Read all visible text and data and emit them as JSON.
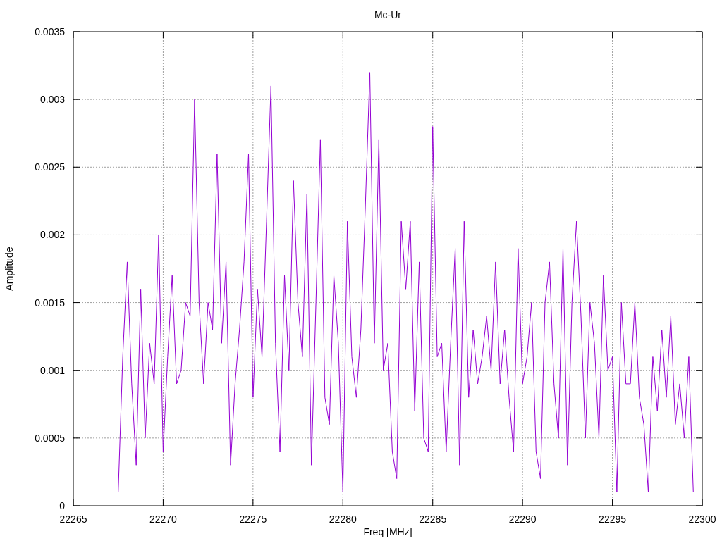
{
  "chart_data": {
    "type": "line",
    "title": "Mc-Ur",
    "xlabel": "Freq [MHz]",
    "ylabel": "Amplitude",
    "grid": true,
    "xlim": [
      22265,
      22300
    ],
    "ylim": [
      0,
      0.0035
    ],
    "xticks": [
      22265,
      22270,
      22275,
      22280,
      22285,
      22290,
      22295,
      22300
    ],
    "yticks": [
      0,
      0.0005,
      0.001,
      0.0015,
      0.002,
      0.0025,
      0.003,
      0.0035
    ],
    "x": [
      22267.5,
      22267.75,
      22268,
      22268.25,
      22268.5,
      22268.75,
      22269,
      22269.25,
      22269.5,
      22269.75,
      22270,
      22270.25,
      22270.5,
      22270.75,
      22271,
      22271.25,
      22271.5,
      22271.75,
      22272,
      22272.25,
      22272.5,
      22272.75,
      22273,
      22273.25,
      22273.5,
      22273.75,
      22274,
      22274.25,
      22274.5,
      22274.75,
      22275,
      22275.25,
      22275.5,
      22275.75,
      22276,
      22276.25,
      22276.5,
      22276.75,
      22277,
      22277.25,
      22277.5,
      22277.75,
      22278,
      22278.25,
      22278.5,
      22278.75,
      22279,
      22279.25,
      22279.5,
      22279.75,
      22280,
      22280.25,
      22280.5,
      22280.75,
      22281,
      22281.25,
      22281.5,
      22281.75,
      22282,
      22282.25,
      22282.5,
      22282.75,
      22283,
      22283.25,
      22283.5,
      22283.75,
      22284,
      22284.25,
      22284.5,
      22284.75,
      22285,
      22285.25,
      22285.5,
      22285.75,
      22286,
      22286.25,
      22286.5,
      22286.75,
      22287,
      22287.25,
      22287.5,
      22287.75,
      22288,
      22288.25,
      22288.5,
      22288.75,
      22289,
      22289.25,
      22289.5,
      22289.75,
      22290,
      22290.25,
      22290.5,
      22290.75,
      22291,
      22291.25,
      22291.5,
      22291.75,
      22292,
      22292.25,
      22292.5,
      22292.75,
      22293,
      22293.25,
      22293.5,
      22293.75,
      22294,
      22294.25,
      22294.5,
      22294.75,
      22295,
      22295.25,
      22295.5,
      22295.75,
      22296,
      22296.25,
      22296.5,
      22296.75,
      22297,
      22297.25,
      22297.5,
      22297.75,
      22298,
      22298.25,
      22298.5,
      22298.75,
      22299,
      22299.25,
      22299.5
    ],
    "series": [
      {
        "color": "#9400d3",
        "values": [
          0.0001,
          0.0011,
          0.0018,
          0.0009,
          0.0003,
          0.0016,
          0.0005,
          0.0012,
          0.0009,
          0.002,
          0.0004,
          0.0011,
          0.0017,
          0.0009,
          0.001,
          0.0015,
          0.0014,
          0.003,
          0.0015,
          0.0009,
          0.0015,
          0.0013,
          0.0026,
          0.0012,
          0.0018,
          0.0003,
          0.0009,
          0.0013,
          0.0018,
          0.0026,
          0.0008,
          0.0016,
          0.0011,
          0.0021,
          0.0031,
          0.0012,
          0.0004,
          0.0017,
          0.001,
          0.0024,
          0.0015,
          0.0011,
          0.0023,
          0.0003,
          0.0015,
          0.0027,
          0.0008,
          0.0006,
          0.0017,
          0.0012,
          0.0001,
          0.0021,
          0.0011,
          0.0008,
          0.0013,
          0.0022,
          0.0032,
          0.0012,
          0.0027,
          0.001,
          0.0012,
          0.0004,
          0.0002,
          0.0021,
          0.0016,
          0.0021,
          0.0007,
          0.0018,
          0.0005,
          0.0004,
          0.0028,
          0.0011,
          0.0012,
          0.0004,
          0.0012,
          0.0019,
          0.0003,
          0.0021,
          0.0008,
          0.0013,
          0.0009,
          0.0011,
          0.0014,
          0.001,
          0.0018,
          0.0009,
          0.0013,
          0.0008,
          0.0004,
          0.0019,
          0.0009,
          0.0011,
          0.0015,
          0.0004,
          0.0002,
          0.0015,
          0.0018,
          0.0009,
          0.0005,
          0.0019,
          0.0003,
          0.0015,
          0.0021,
          0.0014,
          0.0005,
          0.0015,
          0.0012,
          0.0005,
          0.0017,
          0.001,
          0.0011,
          0.0001,
          0.0015,
          0.0009,
          0.0009,
          0.0015,
          0.0008,
          0.0006,
          0.0001,
          0.0011,
          0.0007,
          0.0013,
          0.0008,
          0.0014,
          0.0006,
          0.0009,
          0.0005,
          0.0011,
          0.0001
        ]
      }
    ]
  }
}
